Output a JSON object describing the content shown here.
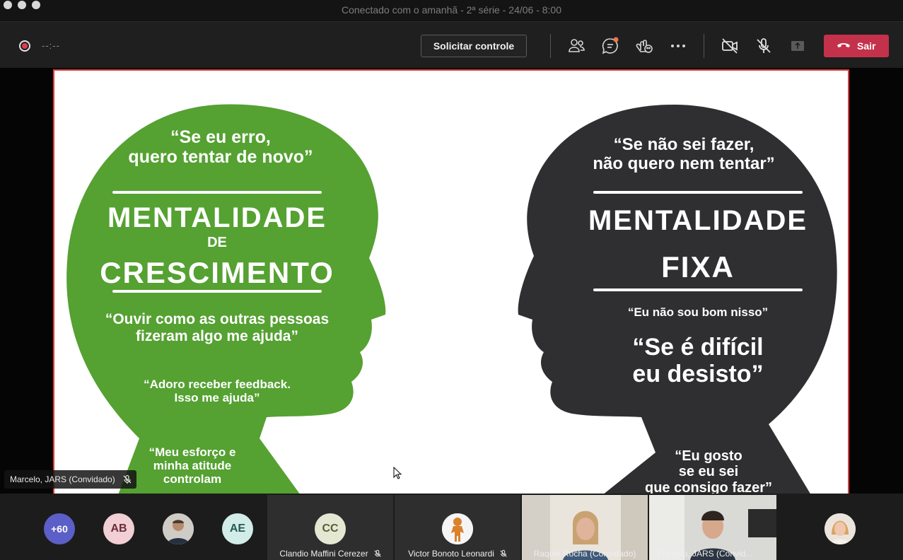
{
  "window": {
    "title": "Conectado com o amanhã - 2ª série - 24/06 - 8:00"
  },
  "toolbar": {
    "timer": "--:--",
    "request_control_label": "Solicitar controle",
    "leave_label": "Sair",
    "icons": [
      "participants-icon",
      "chat-icon",
      "reactions-icon",
      "more-icon",
      "camera-off-icon",
      "mic-off-icon",
      "share-tray-icon",
      "phone-hangup-icon"
    ],
    "accent_colors": {
      "leave": "#c4314b",
      "record": "#e23c4c",
      "chat_badge": "#f0784a"
    }
  },
  "slide": {
    "left": {
      "quote1": "“Se eu erro,\nquero tentar de novo”",
      "title_line1": "MENTALIDADE",
      "title_line2": "DE",
      "title_line3": "CRESCIMENTO",
      "quote2": "“Ouvir como as outras pessoas\nfizeram algo me ajuda”",
      "quote3": "“Adoro receber feedback.\nIsso me ajuda”",
      "quote4": "“Meu esforço e\nminha atitude\ncontrolam",
      "color": "#55a132"
    },
    "right": {
      "quote1": "“Se não sei fazer,\nnão quero nem tentar”",
      "title_line1": "MENTALIDADE",
      "title_line2": "FIXA",
      "quote2": "“Eu não sou bom nisso”",
      "quote3": "“Se é difícil\neu desisto”",
      "quote4": "“Eu gosto\nse eu sei\nque consigo fazer”",
      "color": "#2f2f31"
    },
    "presenter_name": "Marcelo, JARS (Convidado)"
  },
  "participants": {
    "overflow_count": "+60",
    "avatars": [
      {
        "initials": "AB",
        "bg": "#f1cfd4",
        "fg": "#6a2c38"
      },
      {
        "initials": "AE",
        "bg": "#d2ece8",
        "fg": "#245a55"
      }
    ],
    "tiles": [
      {
        "initials": "CC",
        "name": "Clandio Maffini Cerezer"
      },
      {
        "name": "Victor Bonoto Leonardi"
      },
      {
        "name": "Raquel Rocha (Convidado)"
      },
      {
        "name": "Marcelo, JARS (Convid..."
      }
    ]
  }
}
